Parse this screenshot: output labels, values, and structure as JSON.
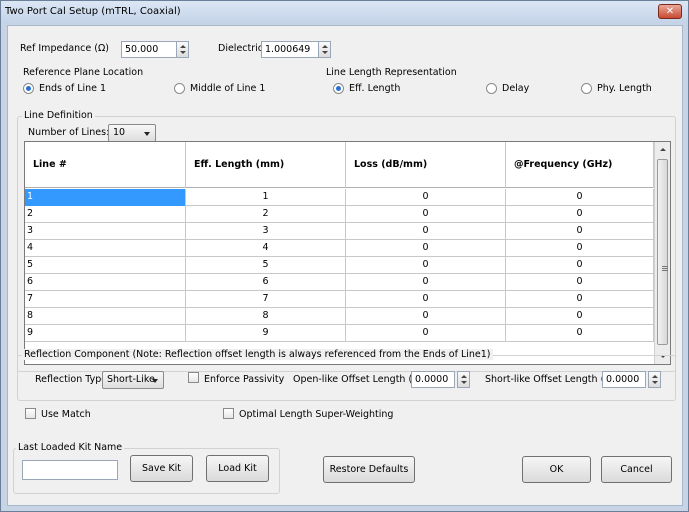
{
  "window": {
    "title": "Two Port Cal Setup (mTRL, Coaxial)",
    "close_glyph": "✕"
  },
  "ref_impedance": {
    "label": "Ref Impedance (Ω)",
    "value": "50.000"
  },
  "dielectric": {
    "label": "Dielectric",
    "value": "1.000649"
  },
  "ref_plane": {
    "title": "Reference Plane Location",
    "options": [
      "Ends of Line 1",
      "Middle of Line 1"
    ],
    "selected": "Ends of Line 1"
  },
  "line_length": {
    "title": "Line Length Representation",
    "options": [
      "Eff. Length",
      "Delay",
      "Phy. Length"
    ],
    "selected": "Eff. Length"
  },
  "line_definition": {
    "title": "Line Definition",
    "num_lines_label": "Number of Lines:",
    "num_lines_value": "10"
  },
  "table": {
    "columns": [
      "Line #",
      "Eff. Length (mm)",
      "Loss (dB/mm)",
      "@Frequency (GHz)"
    ],
    "rows": [
      [
        "1",
        "1",
        "0",
        "0"
      ],
      [
        "2",
        "2",
        "0",
        "0"
      ],
      [
        "3",
        "3",
        "0",
        "0"
      ],
      [
        "4",
        "4",
        "0",
        "0"
      ],
      [
        "5",
        "5",
        "0",
        "0"
      ],
      [
        "6",
        "6",
        "0",
        "0"
      ],
      [
        "7",
        "7",
        "0",
        "0"
      ],
      [
        "8",
        "8",
        "0",
        "0"
      ],
      [
        "9",
        "9",
        "0",
        "0"
      ]
    ],
    "selected_row": 0
  },
  "reflection": {
    "title": "Reflection Component (Note: Reflection offset length is always referenced from the Ends of Line1)",
    "type_label": "Reflection Type",
    "type_value": "Short-Like",
    "enforce_passivity": "Enforce Passivity",
    "open_offset_label": "Open-like Offset Length (mm)",
    "open_offset_value": "0.0000",
    "short_offset_label": "Short-like Offset Length (mm)",
    "short_offset_value": "0.0000"
  },
  "use_match": "Use Match",
  "optimal_length": "Optimal Length Super-Weighting",
  "kit": {
    "title": "Last Loaded Kit Name",
    "value": "",
    "save_label": "Save Kit",
    "load_label": "Load Kit"
  },
  "buttons": {
    "restore": "Restore Defaults",
    "ok": "OK",
    "cancel": "Cancel"
  },
  "colors": {
    "selection": "#3399ff",
    "radio_dot": "#2a6fd4",
    "close": "#c74a32"
  }
}
